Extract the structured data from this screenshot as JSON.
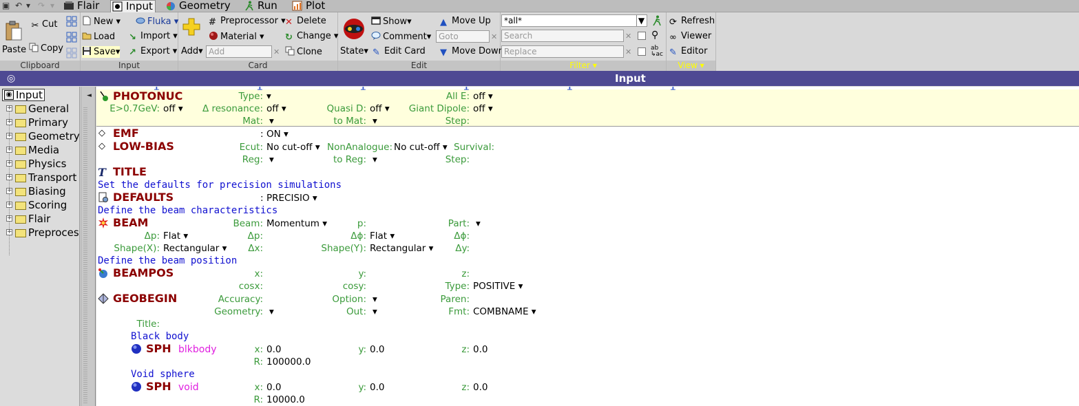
{
  "tabs": [
    {
      "label": "Flair",
      "icon": "flair-icon",
      "active": false
    },
    {
      "label": "Input",
      "icon": "input-icon",
      "active": true
    },
    {
      "label": "Geometry",
      "icon": "geometry-icon",
      "active": false
    },
    {
      "label": "Run",
      "icon": "run-icon",
      "active": false
    },
    {
      "label": "Plot",
      "icon": "plot-icon",
      "active": false
    }
  ],
  "ribbon": {
    "clipboard": {
      "group": "Clipboard",
      "paste": "Paste",
      "cut": "Cut",
      "copy": "Copy"
    },
    "input": {
      "group": "Input",
      "new": "New",
      "load": "Load",
      "save": "Save",
      "fluka": "Fluka",
      "import": "Import",
      "export": "Export"
    },
    "card": {
      "group": "Card",
      "add": "Add",
      "add_placeholder": "Add",
      "preprocessor": "Preprocessor",
      "material": "Material",
      "delete": "Delete",
      "change": "Change",
      "clone": "Clone"
    },
    "edit": {
      "group": "Edit",
      "state": "State",
      "show": "Show",
      "comment": "Comment",
      "edit_card": "Edit Card",
      "move_up": "Move Up",
      "move_down": "Move Down",
      "goto_placeholder": "Goto"
    },
    "filter": {
      "group": "Filter",
      "value": "*all*",
      "search_placeholder": "Search",
      "replace_placeholder": "Replace"
    },
    "view": {
      "group": "View",
      "refresh": "Refresh",
      "viewer": "Viewer",
      "editor": "Editor"
    }
  },
  "title": "Input",
  "tree": {
    "root": "Input",
    "items": [
      "General",
      "Primary",
      "Geometry",
      "Media",
      "Physics",
      "Transport",
      "Biasing",
      "Scoring",
      "Flair",
      "Preproces"
    ]
  },
  "cards": {
    "photonuc": {
      "name": "PHOTONUC",
      "type_l": "Type:",
      "type_v": "▾",
      "alle_l": "All E:",
      "alle_v": "off ▾",
      "e07_l": "E>0.7GeV:",
      "e07_v": "off ▾",
      "dres_l": "Δ resonance:",
      "dres_v": "off ▾",
      "quasid_l": "Quasi D:",
      "quasid_v": "off ▾",
      "giant_l": "Giant Dipole:",
      "giant_v": "off ▾",
      "mat_l": "Mat:",
      "mat_v": "▾",
      "tomat_l": "to Mat:",
      "tomat_v": "▾",
      "step_l": "Step:"
    },
    "emf": {
      "name": "EMF",
      "sep": ":",
      "val": "ON ▾"
    },
    "lowbias": {
      "name": "LOW-BIAS",
      "ecut_l": "Ecut:",
      "ecut_v": "No cut-off ▾",
      "nonana_l": "NonAnalogue:",
      "nonana_v": "No cut-off ▾",
      "surv_l": "Survival:",
      "reg_l": "Reg:",
      "reg_v": "▾",
      "toreg_l": "to Reg:",
      "toreg_v": "▾",
      "step_l": "Step:"
    },
    "title": {
      "name": "TITLE",
      "text": "Set the defaults for precision simulations"
    },
    "defaults": {
      "name": "DEFAULTS",
      "sep": ":",
      "val": "PRECISIO ▾",
      "comment": "Define the beam characteristics"
    },
    "beam": {
      "name": "BEAM",
      "beam_l": "Beam:",
      "beam_v": "Momentum ▾",
      "p_l": "p:",
      "part_l": "Part:",
      "part_v": "▾",
      "dp_l": "Δp:",
      "dp_v": "Flat ▾",
      "dp2_l": "Δp:",
      "dphi_l": "Δϕ:",
      "dphi_v": "Flat ▾",
      "dphi2_l": "Δϕ:",
      "shapex_l": "Shape(X):",
      "shapex_v": "Rectangular ▾",
      "dx_l": "Δx:",
      "shapey_l": "Shape(Y):",
      "shapey_v": "Rectangular ▾",
      "dy_l": "Δy:",
      "comment": "Define the beam position"
    },
    "beampos": {
      "name": "BEAMPOS",
      "x_l": "x:",
      "y_l": "y:",
      "z_l": "z:",
      "cosx_l": "cosx:",
      "cosy_l": "cosy:",
      "type_l": "Type:",
      "type_v": "POSITIVE ▾"
    },
    "geobegin": {
      "name": "GEOBEGIN",
      "acc_l": "Accuracy:",
      "opt_l": "Option:",
      "opt_v": "▾",
      "paren_l": "Paren:",
      "geo_l": "Geometry:",
      "geo_v": "▾",
      "out_l": "Out:",
      "out_v": "▾",
      "fmt_l": "Fmt:",
      "fmt_v": "COMBNAME ▾",
      "title_l": "Title:"
    },
    "sph1": {
      "comment": "Black body",
      "name": "SPH",
      "body": "blkbody",
      "x_l": "x:",
      "x_v": "0.0",
      "y_l": "y:",
      "y_v": "0.0",
      "z_l": "z:",
      "z_v": "0.0",
      "r_l": "R:",
      "r_v": "100000.0"
    },
    "sph2": {
      "comment": "Void sphere",
      "name": "SPH",
      "body": "void",
      "x_l": "x:",
      "x_v": "0.0",
      "y_l": "y:",
      "y_v": "0.0",
      "z_l": "z:",
      "z_v": "0.0",
      "r_l": "R:",
      "r_v": "10000.0"
    }
  },
  "colors": {
    "title_bar": "#4e4993",
    "card_name": "#8b0000",
    "label": "#3a9a3a",
    "comment": "#1010d0",
    "body_name": "#e020e0",
    "highlight": "#ffffdd"
  }
}
